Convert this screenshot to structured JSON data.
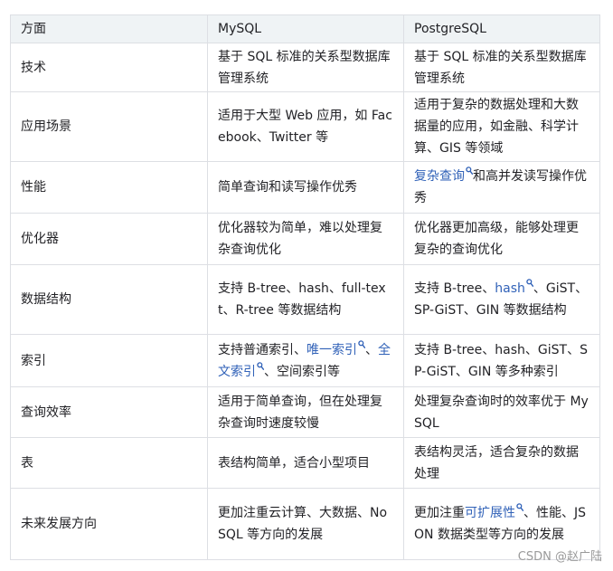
{
  "table": {
    "headers": [
      "方面",
      "MySQL",
      "PostgreSQL"
    ],
    "rows": [
      {
        "aspect": "技术",
        "mysql": [
          {
            "t": "基于 SQL 标准的关系型数据库管理系统"
          }
        ],
        "pg": [
          {
            "t": "基于 SQL 标准的关系型数据库管理系统"
          }
        ]
      },
      {
        "aspect": "应用场景",
        "mysql": [
          {
            "t": "适用于大型 Web 应用，如 Facebook、Twitter 等"
          }
        ],
        "pg": [
          {
            "t": "适用于复杂的数据处理和大数据量的应用，如金融、科学计算、GIS 等领域"
          }
        ]
      },
      {
        "aspect": "性能",
        "mysql": [
          {
            "t": "简单查询和读写操作优秀"
          }
        ],
        "pg": [
          {
            "t": "复杂查询",
            "link": true
          },
          {
            "t": "和高并发读写操作优秀"
          }
        ]
      },
      {
        "aspect": "优化器",
        "mysql": [
          {
            "t": "优化器较为简单，难以处理复杂查询优化"
          }
        ],
        "pg": [
          {
            "t": "优化器更加高级，能够处理更复杂的查询优化"
          }
        ]
      },
      {
        "aspect": "数据结构",
        "mysql": [
          {
            "t": "支持 B-tree、hash、full-text、R-tree 等数据结构"
          }
        ],
        "pg": [
          {
            "t": "支持 B-tree、"
          },
          {
            "t": "hash",
            "link": true
          },
          {
            "t": "、GiST、SP-GiST、GIN 等数据结构"
          }
        ]
      },
      {
        "aspect": "索引",
        "mysql": [
          {
            "t": "支持普通索引、"
          },
          {
            "t": "唯一索引",
            "link": true
          },
          {
            "t": "、"
          },
          {
            "t": "全文索引",
            "link": true
          },
          {
            "t": "、空间索引等"
          }
        ],
        "pg": [
          {
            "t": "支持 B-tree、hash、GiST、SP-GiST、GIN 等多种索引"
          }
        ]
      },
      {
        "aspect": "查询效率",
        "mysql": [
          {
            "t": "适用于简单查询，但在处理复杂查询时速度较慢"
          }
        ],
        "pg": [
          {
            "t": "处理复杂查询时的效率优于 MySQL"
          }
        ]
      },
      {
        "aspect": "表",
        "mysql": [
          {
            "t": "表结构简单，适合小型项目"
          }
        ],
        "pg": [
          {
            "t": "表结构灵活，适合复杂的数据处理"
          }
        ]
      },
      {
        "aspect": "未来发展方向",
        "mysql": [
          {
            "t": "更加注重云计算、大数据、NoSQL 等方向的发展"
          }
        ],
        "pg": [
          {
            "t": "更加注重"
          },
          {
            "t": "可扩展性",
            "link": true
          },
          {
            "t": "、性能、JSON 数据类型等方向的发展"
          }
        ]
      }
    ]
  },
  "link_icon": "search-icon",
  "link_color": "#3162b8",
  "header_bg": "#eff3f5",
  "border_color": "#dddfe4",
  "watermark": "CSDN @赵广陆"
}
